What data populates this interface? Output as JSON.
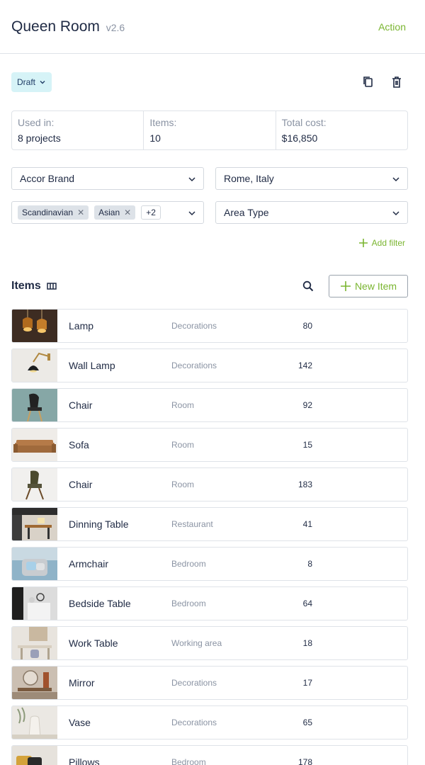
{
  "header": {
    "title": "Queen Room",
    "version": "v2.6",
    "action_label": "Action"
  },
  "status": {
    "label": "Draft"
  },
  "stats": [
    {
      "label": "Used in:",
      "value": "8 projects"
    },
    {
      "label": "Items:",
      "value": "10"
    },
    {
      "label": "Total cost:",
      "value": "$16,850"
    }
  ],
  "filters": {
    "brand": "Accor Brand",
    "location": "Rome, Italy",
    "styles": [
      "Scandinavian",
      "Asian"
    ],
    "styles_more": "+2",
    "area_type": "Area Type",
    "add_filter_label": "Add filter"
  },
  "items_section": {
    "title": "Items",
    "new_item_label": "New Item"
  },
  "items": [
    {
      "name": "Lamp",
      "category": "Decorations",
      "qty": "80"
    },
    {
      "name": "Wall Lamp",
      "category": "Decorations",
      "qty": "142"
    },
    {
      "name": "Chair",
      "category": "Room",
      "qty": "92"
    },
    {
      "name": "Sofa",
      "category": "Room",
      "qty": "15"
    },
    {
      "name": "Chair",
      "category": "Room",
      "qty": "183"
    },
    {
      "name": "Dinning Table",
      "category": "Restaurant",
      "qty": "41"
    },
    {
      "name": "Armchair",
      "category": "Bedroom",
      "qty": "8"
    },
    {
      "name": "Bedside Table",
      "category": "Bedroom",
      "qty": "64"
    },
    {
      "name": "Work Table",
      "category": "Working area",
      "qty": "18"
    },
    {
      "name": "Mirror",
      "category": "Decorations",
      "qty": "17"
    },
    {
      "name": "Vase",
      "category": "Decorations",
      "qty": "65"
    },
    {
      "name": "Pillows",
      "category": "Bedroom",
      "qty": "178"
    }
  ],
  "colors": {
    "accent": "#7ab530",
    "badge_bg": "#d6f3f7",
    "text": "#1f2a44",
    "muted": "#8a93a3"
  },
  "icons": [
    "chevron-down-icon",
    "copy-icon",
    "trash-icon",
    "close-icon",
    "plus-icon",
    "columns-icon",
    "search-icon"
  ]
}
